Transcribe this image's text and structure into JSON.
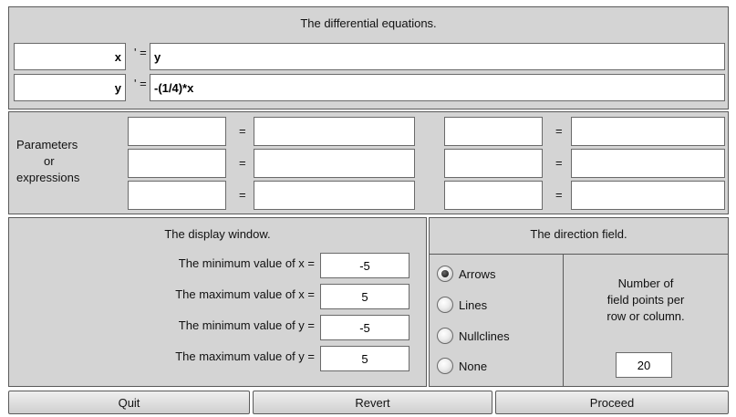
{
  "equations": {
    "title": "The differential equations.",
    "rows": [
      {
        "var": "x",
        "prime": "' =",
        "expr": "y"
      },
      {
        "var": "y",
        "prime": "' =",
        "expr": "-(1/4)*x"
      }
    ]
  },
  "parameters": {
    "label_line1": "Parameters",
    "label_line2": "or",
    "label_line3": "expressions",
    "equals": "="
  },
  "display_window": {
    "title": "The display window.",
    "rows": [
      {
        "label": "The minimum value of x =",
        "value": "-5"
      },
      {
        "label": "The maximum value of x =",
        "value": "5"
      },
      {
        "label": "The minimum value of y =",
        "value": "-5"
      },
      {
        "label": "The maximum value of y =",
        "value": "5"
      }
    ]
  },
  "direction_field": {
    "title": "The direction field.",
    "options": [
      {
        "label": "Arrows",
        "selected": true
      },
      {
        "label": "Lines",
        "selected": false
      },
      {
        "label": "Nullclines",
        "selected": false
      },
      {
        "label": "None",
        "selected": false
      }
    ],
    "points_label_line1": "Number of",
    "points_label_line2": "field points per",
    "points_label_line3": "row or column.",
    "points_value": "20"
  },
  "buttons": {
    "quit": "Quit",
    "revert": "Revert",
    "proceed": "Proceed"
  }
}
